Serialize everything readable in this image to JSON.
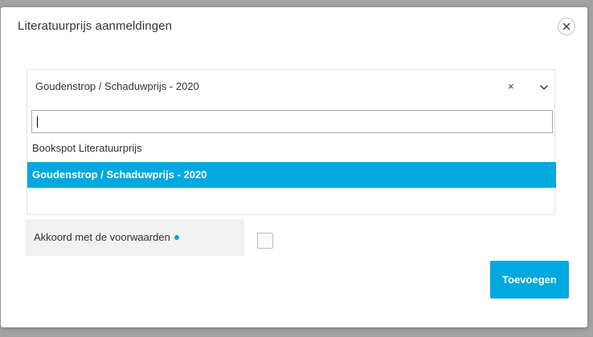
{
  "modal": {
    "title": "Literatuurprijs aanmeldingen",
    "close_icon": "close-icon"
  },
  "prize_select": {
    "selected_value": "Goudenstrop / Schaduwprijs - 2020",
    "clear_symbol": "×",
    "search_value": "",
    "options": [
      {
        "label": "Bookspot Literatuurprijs",
        "highlighted": false
      },
      {
        "label": "Goudenstrop / Schaduwprijs - 2020",
        "highlighted": true
      }
    ]
  },
  "terms": {
    "label": "Akkoord met de voorwaarden",
    "checked": false
  },
  "actions": {
    "submit_label": "Toevoegen"
  },
  "colors": {
    "accent": "#00a8e0",
    "backdrop": "#a3a3a3"
  }
}
